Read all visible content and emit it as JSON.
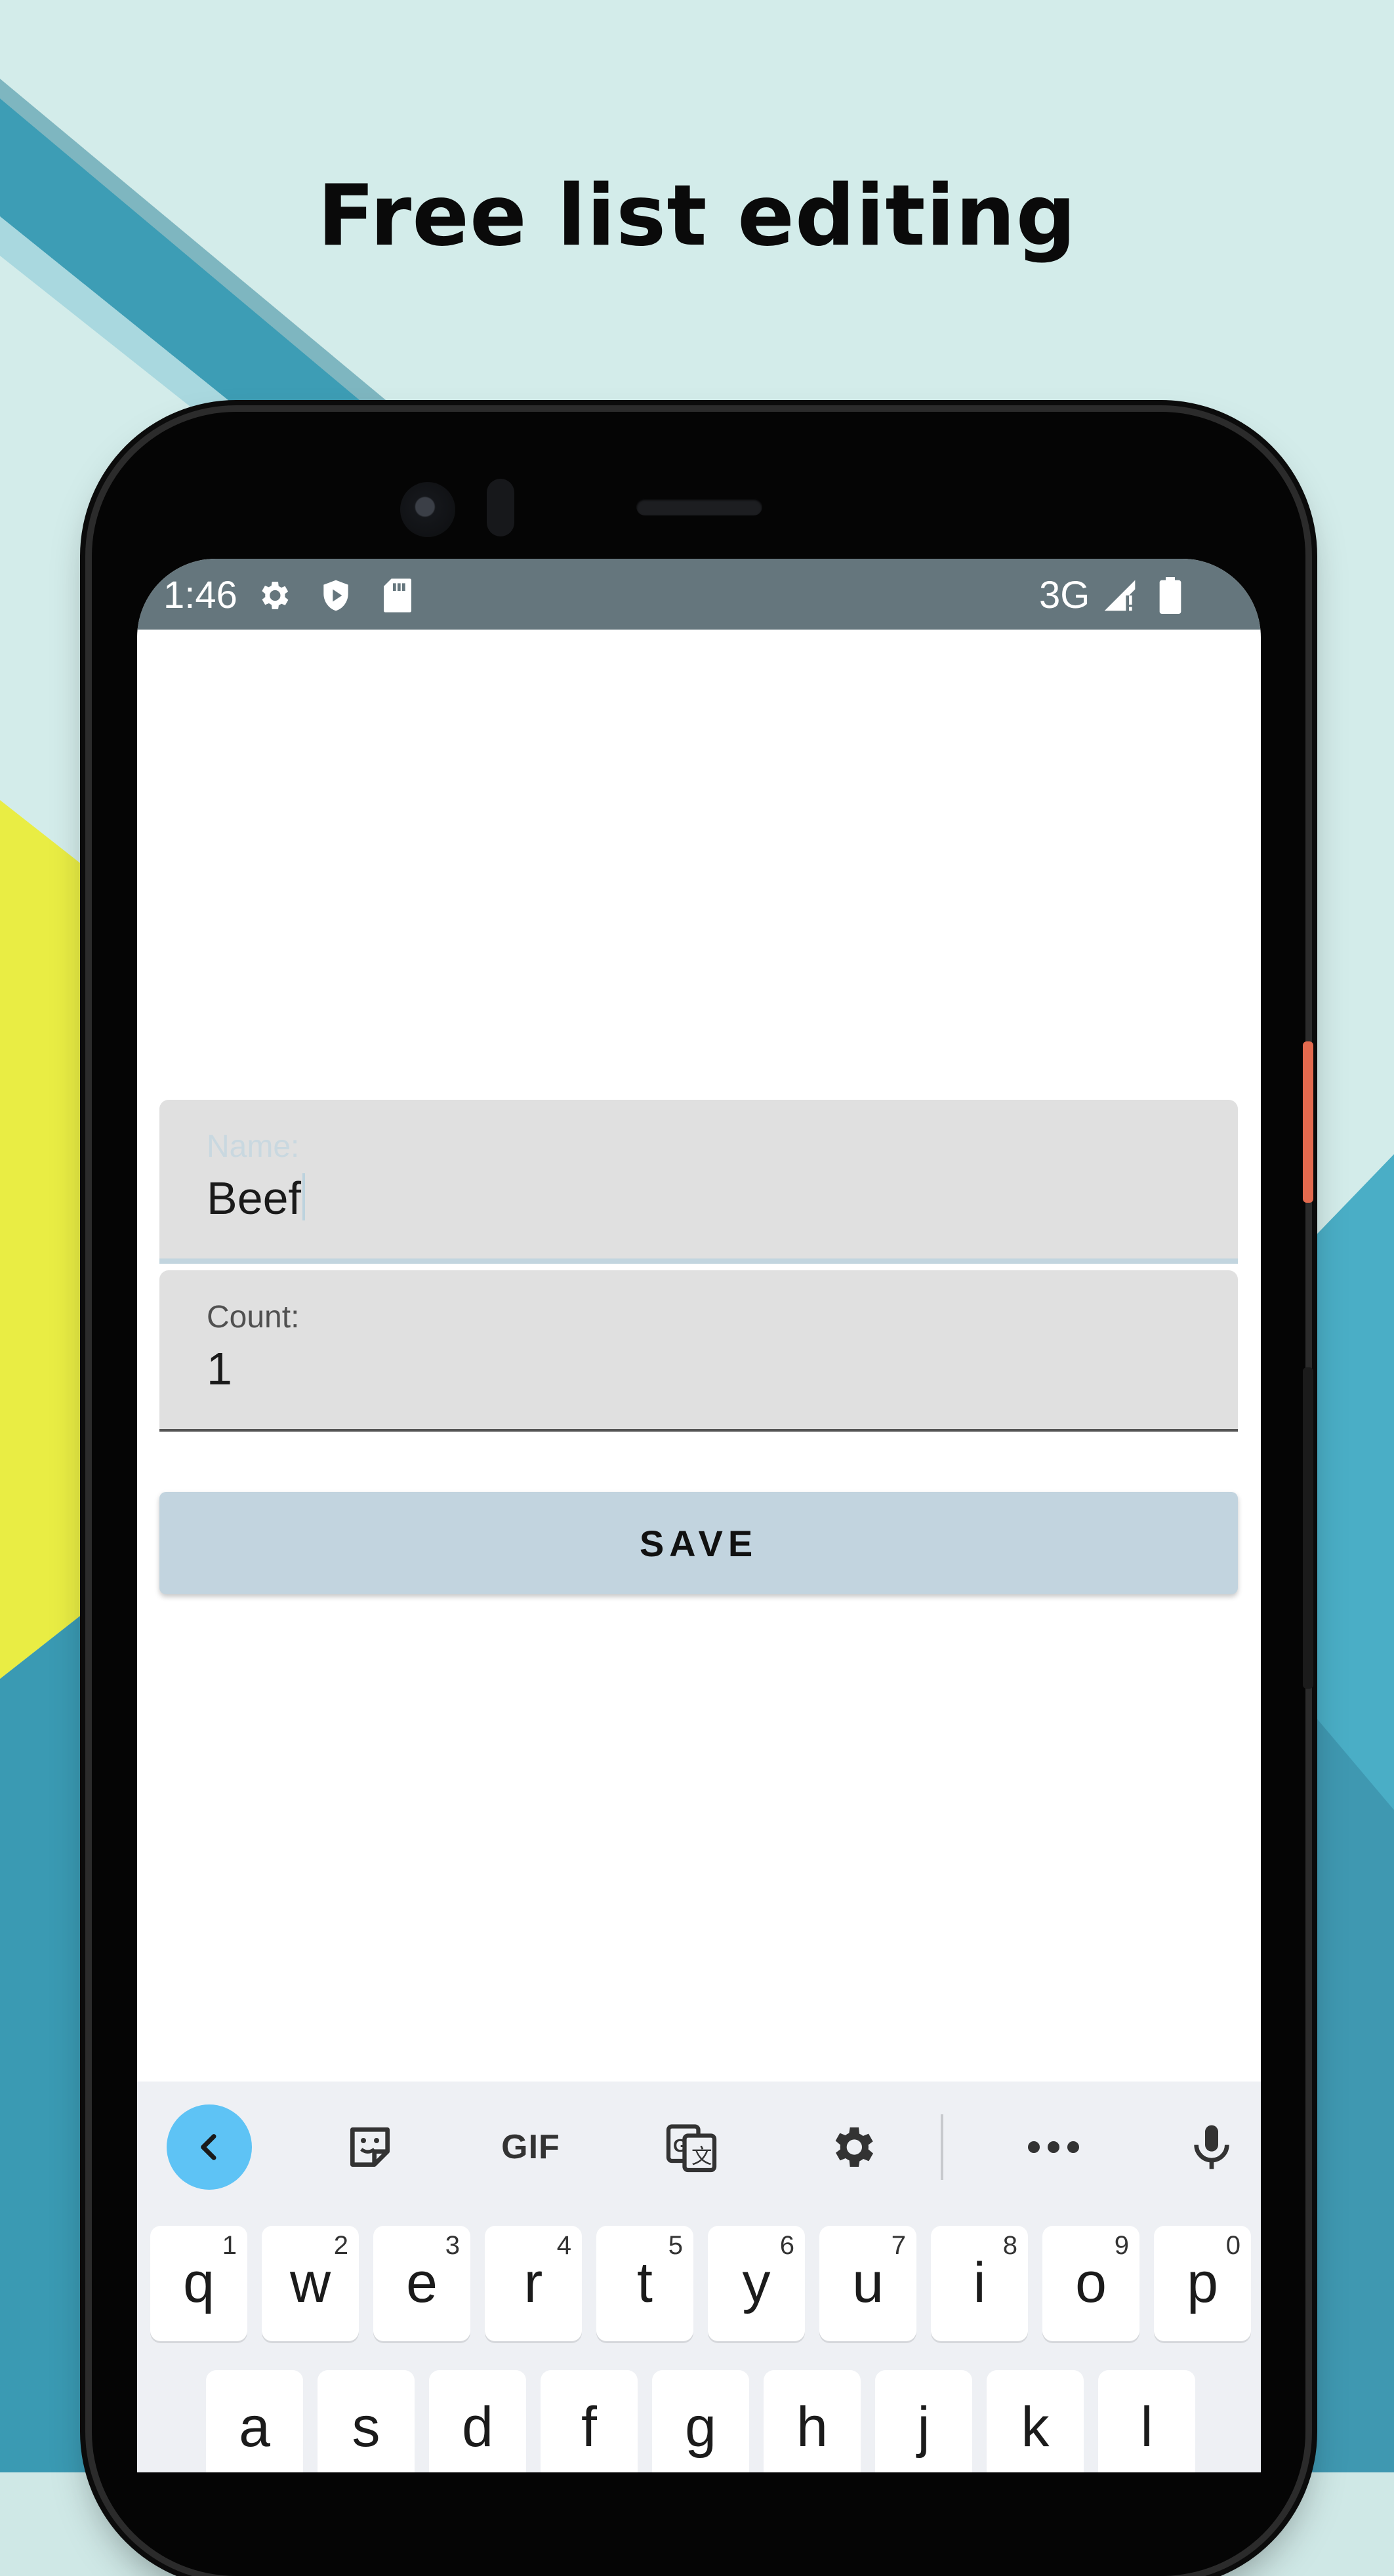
{
  "headline": "Free list editing",
  "status_bar": {
    "time": "1:46",
    "network": "3G",
    "icons": [
      "gear-icon",
      "shield-play-icon",
      "sd-card-icon",
      "signal-icon",
      "battery-icon"
    ]
  },
  "form": {
    "name_label": "Name:",
    "name_value": "Beef",
    "count_label": "Count:",
    "count_value": "1",
    "save_label": "SAVE"
  },
  "keyboard": {
    "toolbar": [
      "back-icon",
      "sticker-icon",
      "GIF",
      "translate-icon",
      "settings-icon",
      "more-icon",
      "mic-icon"
    ],
    "gif_label": "GIF",
    "row1": [
      {
        "char": "q",
        "sup": "1"
      },
      {
        "char": "w",
        "sup": "2"
      },
      {
        "char": "e",
        "sup": "3"
      },
      {
        "char": "r",
        "sup": "4"
      },
      {
        "char": "t",
        "sup": "5"
      },
      {
        "char": "y",
        "sup": "6"
      },
      {
        "char": "u",
        "sup": "7"
      },
      {
        "char": "i",
        "sup": "8"
      },
      {
        "char": "o",
        "sup": "9"
      },
      {
        "char": "p",
        "sup": "0"
      }
    ],
    "row2": [
      {
        "char": "a"
      },
      {
        "char": "s"
      },
      {
        "char": "d"
      },
      {
        "char": "f"
      },
      {
        "char": "g"
      },
      {
        "char": "h"
      },
      {
        "char": "j"
      },
      {
        "char": "k"
      },
      {
        "char": "l"
      }
    ]
  },
  "colors": {
    "status_bar": "#65767d",
    "save_button": "#c2d4df",
    "field_background": "#e0e0e0",
    "keyboard_background": "#eef0f4",
    "back_button": "#5ec3f5"
  }
}
